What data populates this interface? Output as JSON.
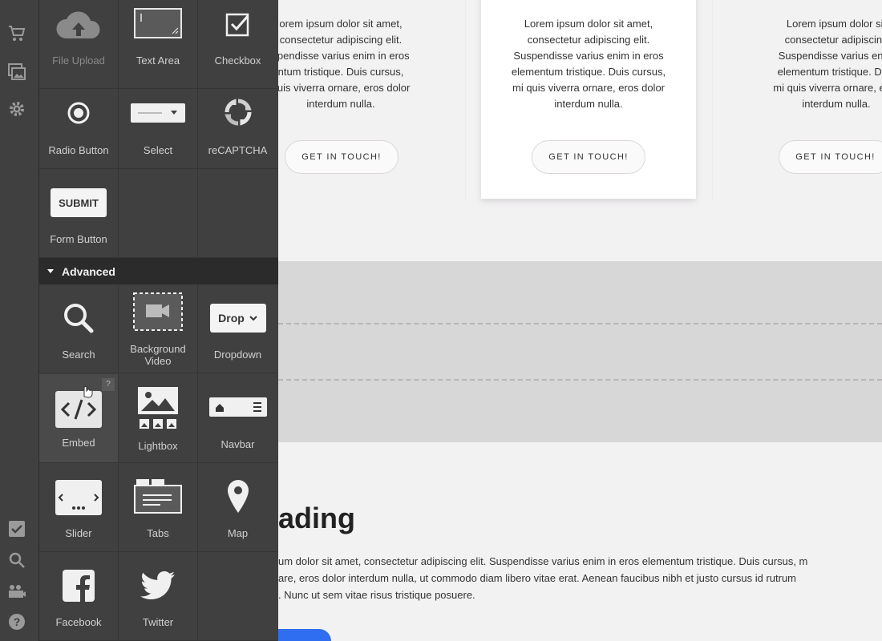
{
  "panel": {
    "tiles": [
      {
        "label": "File Upload",
        "icon": "cloud-upload-icon"
      },
      {
        "label": "Text Area",
        "icon": "text-area-icon"
      },
      {
        "label": "Checkbox",
        "icon": "checkbox-icon"
      },
      {
        "label": "Radio Button",
        "icon": "radio-button-icon"
      },
      {
        "label": "Select",
        "icon": "select-icon"
      },
      {
        "label": "reCAPTCHA",
        "icon": "recaptcha-icon"
      },
      {
        "label": "Form Button",
        "icon": "submit-button-icon",
        "button_text": "SUBMIT"
      }
    ],
    "advanced_header": "Advanced",
    "advanced_tiles": [
      {
        "label": "Search",
        "icon": "search-icon"
      },
      {
        "label": "Background Video",
        "icon": "video-icon"
      },
      {
        "label": "Dropdown",
        "icon": "dropdown-icon",
        "button_text": "Drop"
      },
      {
        "label": "Embed",
        "icon": "code-icon",
        "help": "?"
      },
      {
        "label": "Lightbox",
        "icon": "image-icon"
      },
      {
        "label": "Navbar",
        "icon": "navbar-icon"
      },
      {
        "label": "Slider",
        "icon": "slider-icon"
      },
      {
        "label": "Tabs",
        "icon": "tabs-icon"
      },
      {
        "label": "Map",
        "icon": "map-pin-icon"
      },
      {
        "label": "Facebook",
        "icon": "facebook-icon"
      },
      {
        "label": "Twitter",
        "icon": "twitter-icon"
      }
    ]
  },
  "rail": {
    "icons": [
      "cart-icon",
      "gallery-icon",
      "gear-icon",
      "check-icon",
      "search-icon",
      "users-icon",
      "help-icon"
    ]
  },
  "canvas": {
    "cards": [
      {
        "lines": [
          "orem ipsum dolor sit amet,",
          "consectetur adipiscing elit.",
          "spendisse varius enim in eros",
          "ntum tristique. Duis cursus,",
          "quis viverra ornare, eros dolor",
          "interdum nulla."
        ],
        "button": "GET IN TOUCH!"
      },
      {
        "lines": [
          "Lorem ipsum dolor sit amet,",
          "consectetur adipiscing elit.",
          "Suspendisse varius enim in eros",
          "elementum tristique. Duis cursus,",
          "mi quis viverra ornare, eros dolor",
          "interdum nulla."
        ],
        "button": "GET IN TOUCH!"
      },
      {
        "lines": [
          "Lorem ipsum dolor sit",
          "consectetur adipiscing",
          "Suspendisse varius enim",
          "elementum tristique. Duis",
          "mi quis viverra ornare, eros",
          "interdum nulla."
        ],
        "button": "GET IN TOUCH!"
      }
    ],
    "heading": "ading",
    "paragraph": [
      "um dolor sit amet, consectetur adipiscing elit. Suspendisse varius enim in eros elementum tristique. Duis cursus, m",
      "are, eros dolor interdum nulla, ut commodo diam libero vitae erat. Aenean faucibus nibh et justo cursus id rutrum",
      ". Nunc ut sem vitae risus tristique posuere."
    ]
  },
  "colors": {
    "panel_bg": "#404040",
    "section_header": "#2b2b2b",
    "canvas_bg": "#f3f2f3",
    "accent_blue": "#2f6ef0"
  }
}
